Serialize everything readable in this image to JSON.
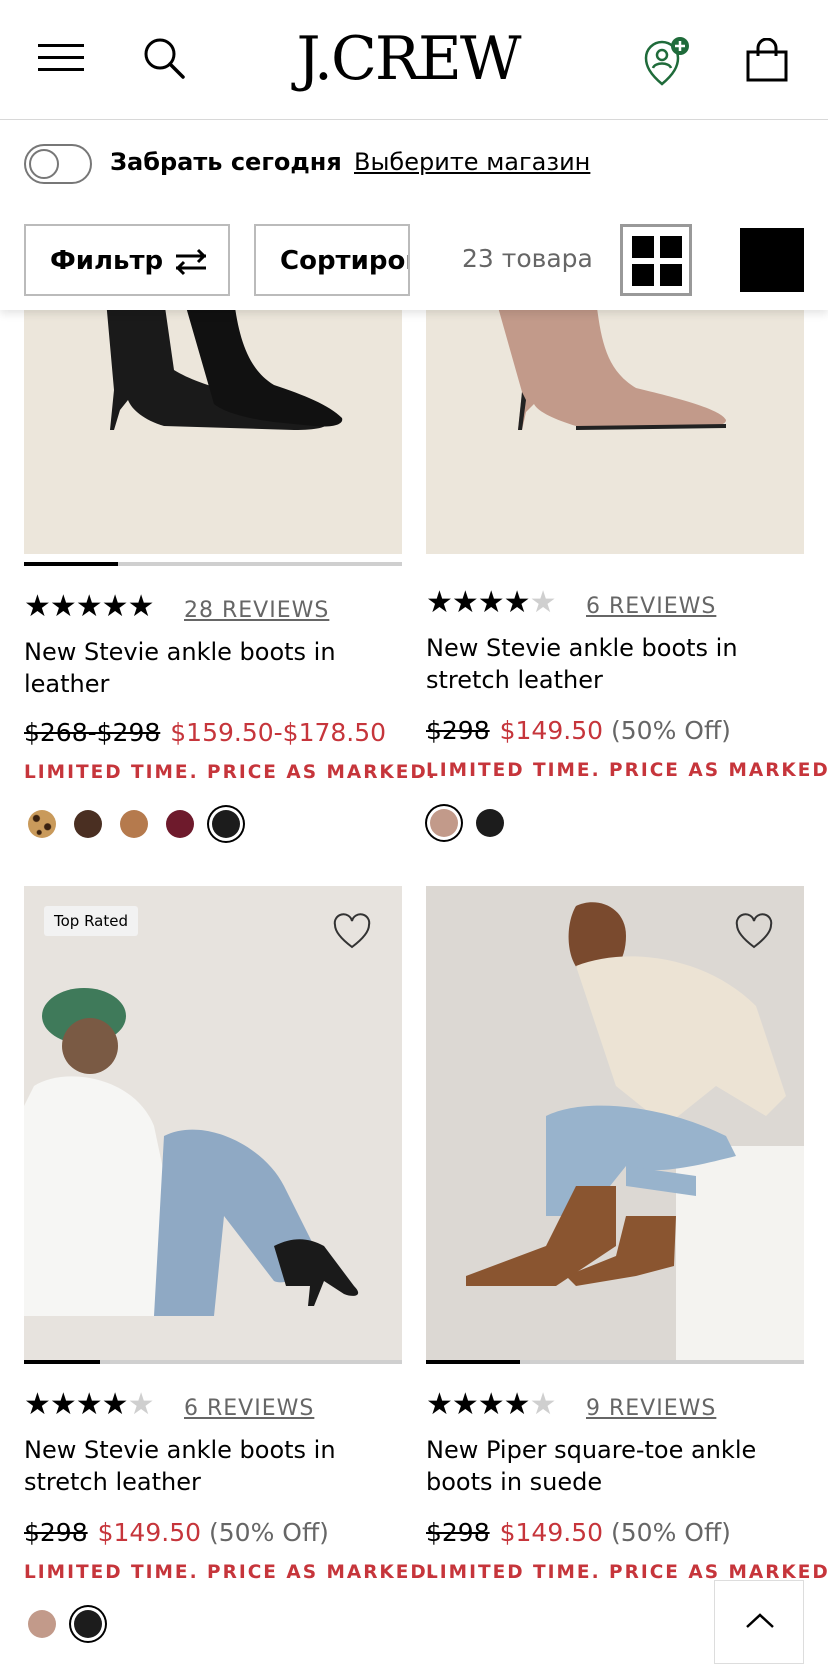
{
  "header": {
    "logo": "J.CREW",
    "icons": [
      "hamburger-icon",
      "search-icon",
      "account-icon",
      "bag-icon"
    ]
  },
  "toolbar": {
    "pickup_label": "Забрать сегодня",
    "store_link": "Выберите магазин",
    "filter_label": "Фильтр",
    "sort_label": "Сортировка",
    "count": "23 товара"
  },
  "colors": {
    "sale_red": "#c6353b",
    "star": "#000000",
    "muted": "#666666"
  },
  "products": [
    {
      "reviews": "28 REVIEWS",
      "rating": 4.5,
      "name": "New Stevie ankle boots in leather",
      "old_price": "$268-$298",
      "new_price": "$159.50-$178.50",
      "discount": "",
      "promo": "LIMITED TIME. PRICE AS MARKED.",
      "swatches": [
        "leopard",
        "#4a2f22",
        "#b57a4d",
        "#6e1a2c",
        "#1c1c1c"
      ],
      "selected_swatch": 4
    },
    {
      "reviews": "6 REVIEWS",
      "rating": 4.5,
      "name": "New Stevie ankle boots in stretch leather",
      "old_price": "$298",
      "new_price": "$149.50",
      "discount": "(50% Off)",
      "promo": "LIMITED TIME. PRICE AS MARKED.",
      "swatches": [
        "#c29a8a",
        "#1c1c1c"
      ],
      "selected_swatch": 0
    },
    {
      "badge": "Top Rated",
      "reviews": "6 REVIEWS",
      "rating": 4.5,
      "name": "New Stevie ankle boots in stretch leather",
      "old_price": "$298",
      "new_price": "$149.50",
      "discount": "(50% Off)",
      "promo": "LIMITED TIME. PRICE AS MARKED.",
      "swatches": [
        "#c29a8a",
        "#1c1c1c"
      ],
      "selected_swatch": 1
    },
    {
      "reviews": "9 REVIEWS",
      "rating": 4,
      "name": "New Piper square-toe ankle boots in suede",
      "old_price": "$298",
      "new_price": "$149.50",
      "discount": "(50% Off)",
      "promo": "LIMITED TIME. PRICE AS MARKED.",
      "swatches": [],
      "selected_swatch": -1
    }
  ]
}
